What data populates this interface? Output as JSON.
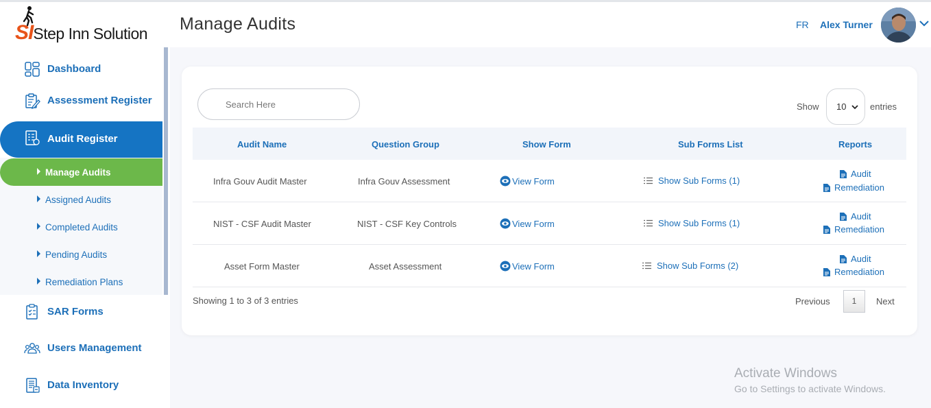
{
  "header": {
    "logo_si": "SI",
    "logo_text": "Step Inn Solution",
    "title": "Manage Audits",
    "lang": "FR",
    "user": "Alex Turner"
  },
  "sidebar": {
    "items": [
      {
        "label": "Dashboard",
        "icon": "dashboard-icon"
      },
      {
        "label": "Assessment Register",
        "icon": "clipboard-edit-icon"
      },
      {
        "label": "Audit Register",
        "icon": "document-list-icon",
        "active": true
      },
      {
        "label": "SAR Forms",
        "icon": "checklist-icon"
      },
      {
        "label": "Users Management",
        "icon": "users-icon"
      },
      {
        "label": "Data Inventory",
        "icon": "inventory-icon"
      }
    ],
    "subitems": [
      {
        "label": "Manage Audits",
        "active": true
      },
      {
        "label": "Assigned Audits"
      },
      {
        "label": "Completed Audits"
      },
      {
        "label": "Pending Audits"
      },
      {
        "label": "Remediation Plans"
      }
    ]
  },
  "table_controls": {
    "search_placeholder": "Search Here",
    "show_label": "Show",
    "entries_value": "10",
    "entries_label": "entries"
  },
  "table": {
    "headers": [
      "Audit Name",
      "Question Group",
      "Show Form",
      "Sub Forms List",
      "Reports"
    ],
    "rows": [
      {
        "audit_name": "Infra Gouv Audit Master",
        "question_group": "Infra Gouv Assessment",
        "show_form": "View Form",
        "sub_forms": "Show Sub Forms (1)",
        "report_audit": "Audit",
        "report_remediation": "Remediation"
      },
      {
        "audit_name": "NIST - CSF Audit Master",
        "question_group": "NIST - CSF Key Controls",
        "show_form": "View Form",
        "sub_forms": "Show Sub Forms (1)",
        "report_audit": "Audit",
        "report_remediation": "Remediation"
      },
      {
        "audit_name": "Asset Form Master",
        "question_group": "Asset Assessment",
        "show_form": "View Form",
        "sub_forms": "Show Sub Forms (2)",
        "report_audit": "Audit",
        "report_remediation": "Remediation"
      }
    ]
  },
  "pagination": {
    "info": "Showing 1 to 3 of 3 entries",
    "previous": "Previous",
    "page": "1",
    "next": "Next"
  },
  "watermark": {
    "line1": "Activate Windows",
    "line2": "Go to Settings to activate Windows."
  },
  "colors": {
    "primary": "#1c6fb8",
    "active_nav": "#1574c3",
    "active_sub": "#6cb84a",
    "logo_accent": "#e8541a"
  }
}
